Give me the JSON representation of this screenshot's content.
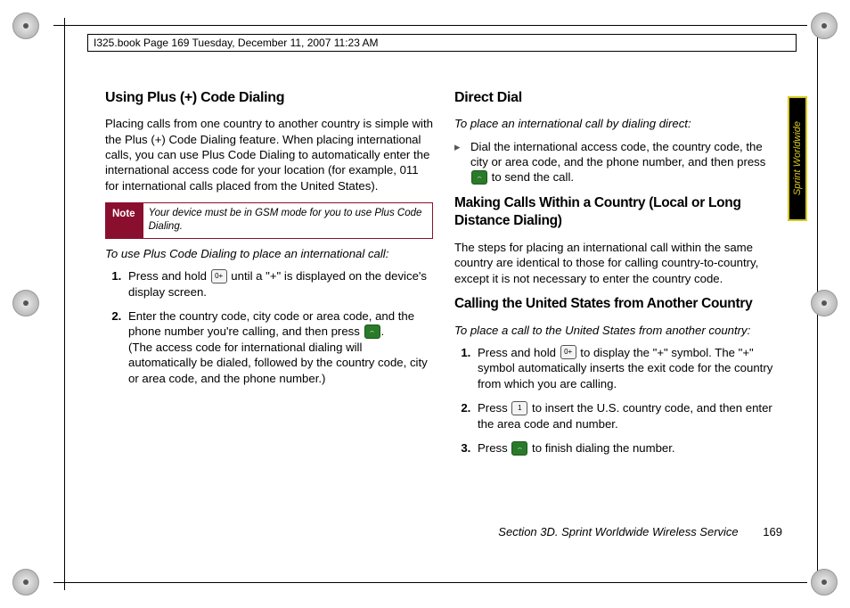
{
  "header_stamp": "I325.book  Page 169  Tuesday, December 11, 2007  11:23 AM",
  "tab_label": "Sprint Worldwide",
  "footer_section": "Section 3D. Sprint Worldwide Wireless Service",
  "footer_page": "169",
  "left": {
    "h2": "Using Plus (+) Code Dialing",
    "p1": "Placing calls from one country to another country is simple with the Plus (+) Code Dialing feature. When placing international calls, you can use Plus Code Dialing to automatically enter the international access code for your location (for example, 011 for international calls placed from the United States).",
    "note_label": "Note",
    "note_body": "Your device must be in GSM mode for you to use Plus Code Dialing.",
    "instr": "To use Plus Code Dialing to place an international call:",
    "step1a": "Press and hold ",
    "step1b": " until a \"+\" is displayed on the device's display screen.",
    "step2a": "Enter the country code, city code or area code, and the phone number you're calling, and then press ",
    "step2b": ".",
    "step2c": "(The access code for international dialing will automatically be dialed, followed by the country code, city or area code, and the phone number.)",
    "key0": "0+",
    "keycall": "⌢"
  },
  "right": {
    "h2a": "Direct Dial",
    "instr_a": "To place an international call by dialing direct:",
    "bullet_a1": "Dial the international access code, the country code, the city or area code, and the phone number, and then press ",
    "bullet_a2": " to send the call.",
    "h2b": "Making Calls Within a Country (Local or Long Distance Dialing)",
    "p_b": "The steps for placing an international call within the same country are identical to those for calling country-to-country, except it is not necessary to enter the country code.",
    "h2c": "Calling the United States from Another Country",
    "instr_c": "To place a call to the United States from another country:",
    "c_step1a": "Press and hold ",
    "c_step1b": " to display the \"+\" symbol. The \"+\" symbol automatically inserts the exit code for the country from which you are calling.",
    "c_step2a": "Press ",
    "c_step2b": " to insert the U.S. country code, and then enter the area code and number.",
    "c_step3a": "Press ",
    "c_step3b": " to finish dialing the number.",
    "key0": "0+",
    "key1": "1",
    "keycall": "⌢"
  }
}
